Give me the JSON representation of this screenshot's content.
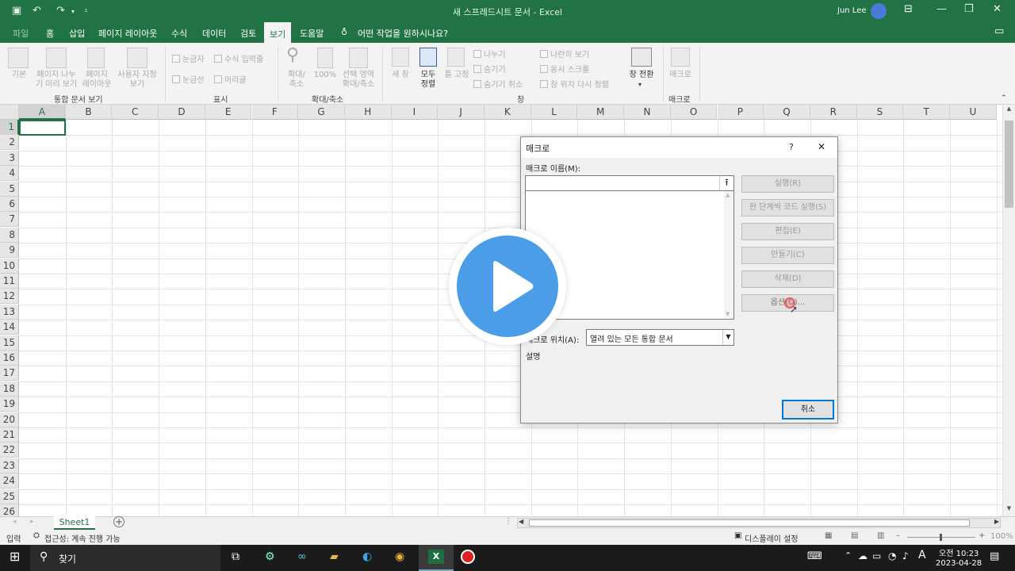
{
  "titlebar": {
    "title": "새 스프레드시트 문서  -  Excel",
    "user": "Jun Lee"
  },
  "tabs": [
    {
      "label": "파일"
    },
    {
      "label": "홈"
    },
    {
      "label": "삽입"
    },
    {
      "label": "페이지 레이아웃"
    },
    {
      "label": "수식"
    },
    {
      "label": "데이터"
    },
    {
      "label": "검토"
    },
    {
      "label": "보기"
    },
    {
      "label": "도움말"
    }
  ],
  "tell_me": "어떤 작업을 원하시나요?",
  "ribbon": {
    "workbook_views": {
      "group": "통합 문서 보기",
      "normal": "기본",
      "page_break": "페이지 나누\n기 미리 보기",
      "page_layout": "페이지\n레이아웃",
      "custom": "사용자 지정\n보기"
    },
    "show": {
      "group": "표시",
      "ruler": "눈금자",
      "gridlines": "눈금선",
      "formula_bar": "수식 입력줄",
      "headings": "머리글"
    },
    "zoom": {
      "group": "확대/축소",
      "zoom": "확대/\n축소",
      "hundred": "100%",
      "to_selection": "선택 영역\n확대/축소"
    },
    "window": {
      "group": "창",
      "new": "새 창",
      "arrange": "모두\n정렬",
      "freeze": "틀 고정",
      "split": "나누기",
      "hide": "숨기기",
      "unhide": "숨기기 취소",
      "side_by_side": "나란히 보기",
      "sync_scroll": "동시 스크롤",
      "reset_pos": "창 위치 다시 정렬",
      "switch": "창 전환"
    },
    "macros": {
      "group": "매크로",
      "macros": "매크로"
    }
  },
  "columns": [
    "A",
    "B",
    "C",
    "D",
    "E",
    "F",
    "G",
    "H",
    "I",
    "J",
    "K",
    "L",
    "M",
    "N",
    "O",
    "P",
    "Q",
    "R",
    "S",
    "T",
    "U"
  ],
  "rows": [
    "1",
    "2",
    "3",
    "4",
    "5",
    "6",
    "7",
    "8",
    "9",
    "10",
    "11",
    "12",
    "13",
    "14",
    "15",
    "16",
    "17",
    "18",
    "19",
    "20",
    "21",
    "22",
    "23",
    "24",
    "25",
    "26"
  ],
  "sheet": {
    "tab": "Sheet1"
  },
  "status": {
    "mode": "입력",
    "accessibility": "접근성: 계속 진행 가능",
    "display": "디스플레이 설정",
    "zoom": "100%"
  },
  "taskbar": {
    "search": "찾기",
    "time": "오전 10:23",
    "date": "2023-04-28",
    "ime": "A"
  },
  "dialog": {
    "title": "매크로",
    "help": "?",
    "close": "✕",
    "name_label": "매크로 이름(M):",
    "name_value": "",
    "buttons": {
      "run": "실행(R)",
      "step": "한 단계씩 코드 실행(S)",
      "edit": "편집(E)",
      "create": "만들기(C)",
      "delete": "삭제(D)",
      "options": "옵션(O)..."
    },
    "location_label": "매크로 위치(A):",
    "location_value": "열려 있는 모든 통합 문서",
    "description_label": "설명",
    "cancel": "취소"
  },
  "colors": {
    "accent": "#217346",
    "play": "#4a9de6"
  }
}
